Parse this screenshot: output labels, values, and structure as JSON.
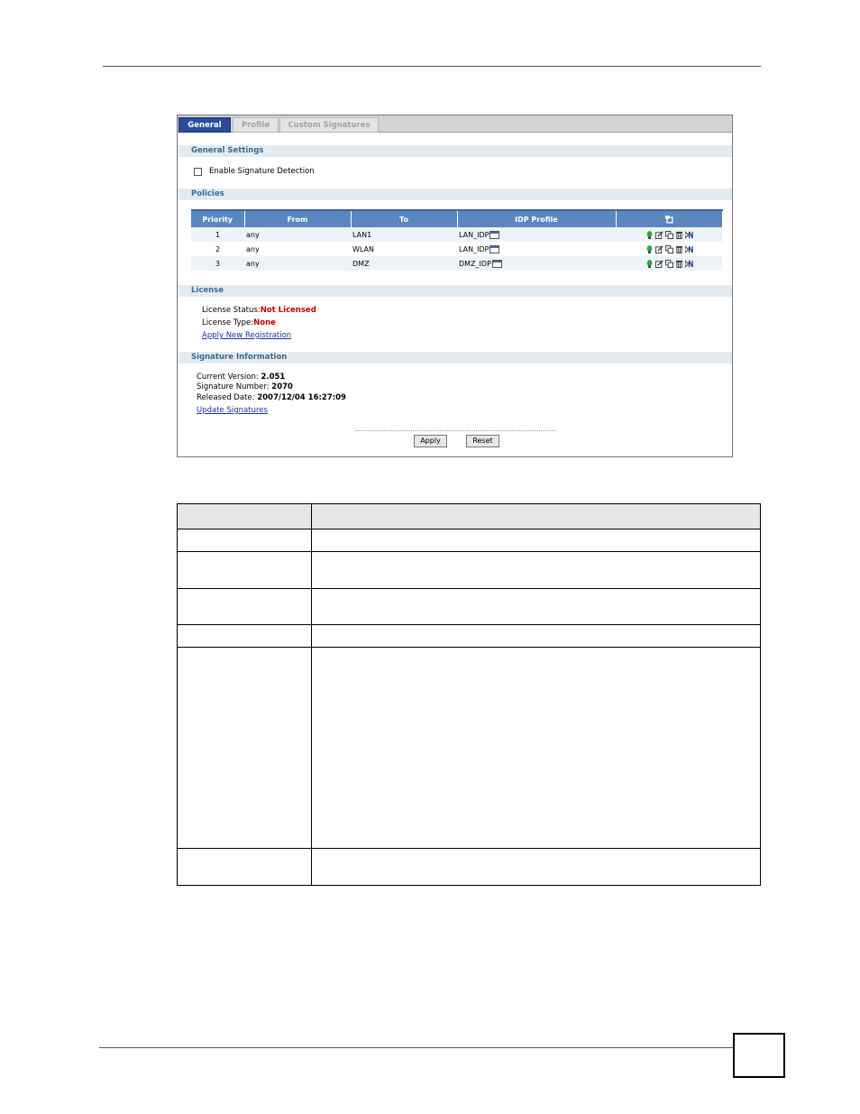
{
  "tabs": [
    {
      "label": "General",
      "active": true
    },
    {
      "label": "Profile",
      "active": false
    },
    {
      "label": "Custom Signatures",
      "active": false
    }
  ],
  "sections": {
    "general_settings": "General Settings",
    "policies": "Policies",
    "license": "License",
    "signature_information": "Signature Information"
  },
  "general": {
    "enable_signature_detection_label": "Enable Signature Detection",
    "enable_signature_detection_checked": false
  },
  "policies_table": {
    "columns": [
      "Priority",
      "From",
      "To",
      "IDP Profile"
    ],
    "rows": [
      {
        "priority": "1",
        "from": "any",
        "to": "LAN1",
        "idp_profile": "LAN_IDP"
      },
      {
        "priority": "2",
        "from": "any",
        "to": "WLAN",
        "idp_profile": "LAN_IDP"
      },
      {
        "priority": "3",
        "from": "any",
        "to": "DMZ",
        "idp_profile": "DMZ_IDP"
      }
    ],
    "row_actions": [
      "status-icon",
      "edit-icon",
      "copy-icon",
      "delete-icon",
      "move-icon"
    ]
  },
  "license": {
    "status_label": "License Status:",
    "status_value": "Not Licensed",
    "type_label": "License Type:",
    "type_value": "None",
    "apply_link": "Apply New Registration"
  },
  "signature": {
    "version_label": "Current Version: ",
    "version_value": "2.051",
    "number_label": "Signature Number: ",
    "number_value": "2070",
    "date_label": "Released Date: ",
    "date_value": "2007/12/04 16:27:09",
    "update_link": "Update Signatures"
  },
  "buttons": {
    "apply": "Apply",
    "reset": "Reset"
  },
  "colors": {
    "active_tab": "#2a4c9a",
    "table_header": "#5b87c0",
    "section_text": "#3c6a8e",
    "alert_red": "#c00000",
    "link_blue": "#1c2f9f"
  }
}
